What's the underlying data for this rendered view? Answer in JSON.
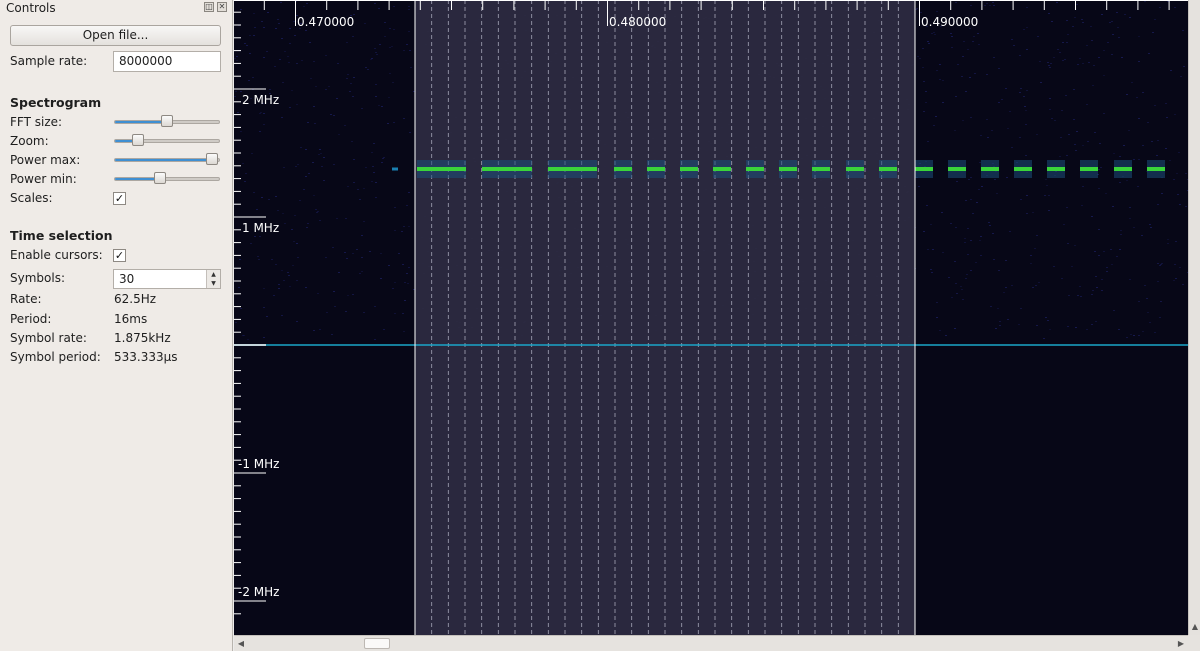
{
  "controls": {
    "title": "Controls",
    "open_file": "Open file...",
    "sample_rate": {
      "label": "Sample rate:",
      "value": "8000000"
    },
    "spectrogram": {
      "heading": "Spectrogram",
      "fft_size": {
        "label": "FFT size:",
        "level": 0.5
      },
      "zoom": {
        "label": "Zoom:",
        "level": 0.23
      },
      "power_max": {
        "label": "Power max:",
        "level": 0.92
      },
      "power_min": {
        "label": "Power min:",
        "level": 0.43
      },
      "scales": {
        "label": "Scales:",
        "checked": true,
        "mark": "✓"
      }
    },
    "time_selection": {
      "heading": "Time selection",
      "enable_cursors": {
        "label": "Enable cursors:",
        "checked": true,
        "mark": "✓"
      },
      "symbols": {
        "label": "Symbols:",
        "value": "30"
      },
      "rate": {
        "label": "Rate:",
        "value": "62.5Hz"
      },
      "period": {
        "label": "Period:",
        "value": "16ms"
      },
      "symbol_rate": {
        "label": "Symbol rate:",
        "value": "1.875kHz"
      },
      "symbol_period": {
        "label": "Symbol period:",
        "value": "533.333µs"
      }
    }
  },
  "plot": {
    "time_labels": [
      "0.470000",
      "0.480000",
      "0.490000"
    ],
    "freq_labels": [
      "2 MHz",
      "1 MHz",
      "-1 MHz",
      "-2 MHz"
    ],
    "colors": {
      "background": "#070717",
      "selection": "#2c2a40",
      "signal": "#3ad43a",
      "center_line": "#1aa6c8",
      "cursor": "#ffffff"
    }
  }
}
